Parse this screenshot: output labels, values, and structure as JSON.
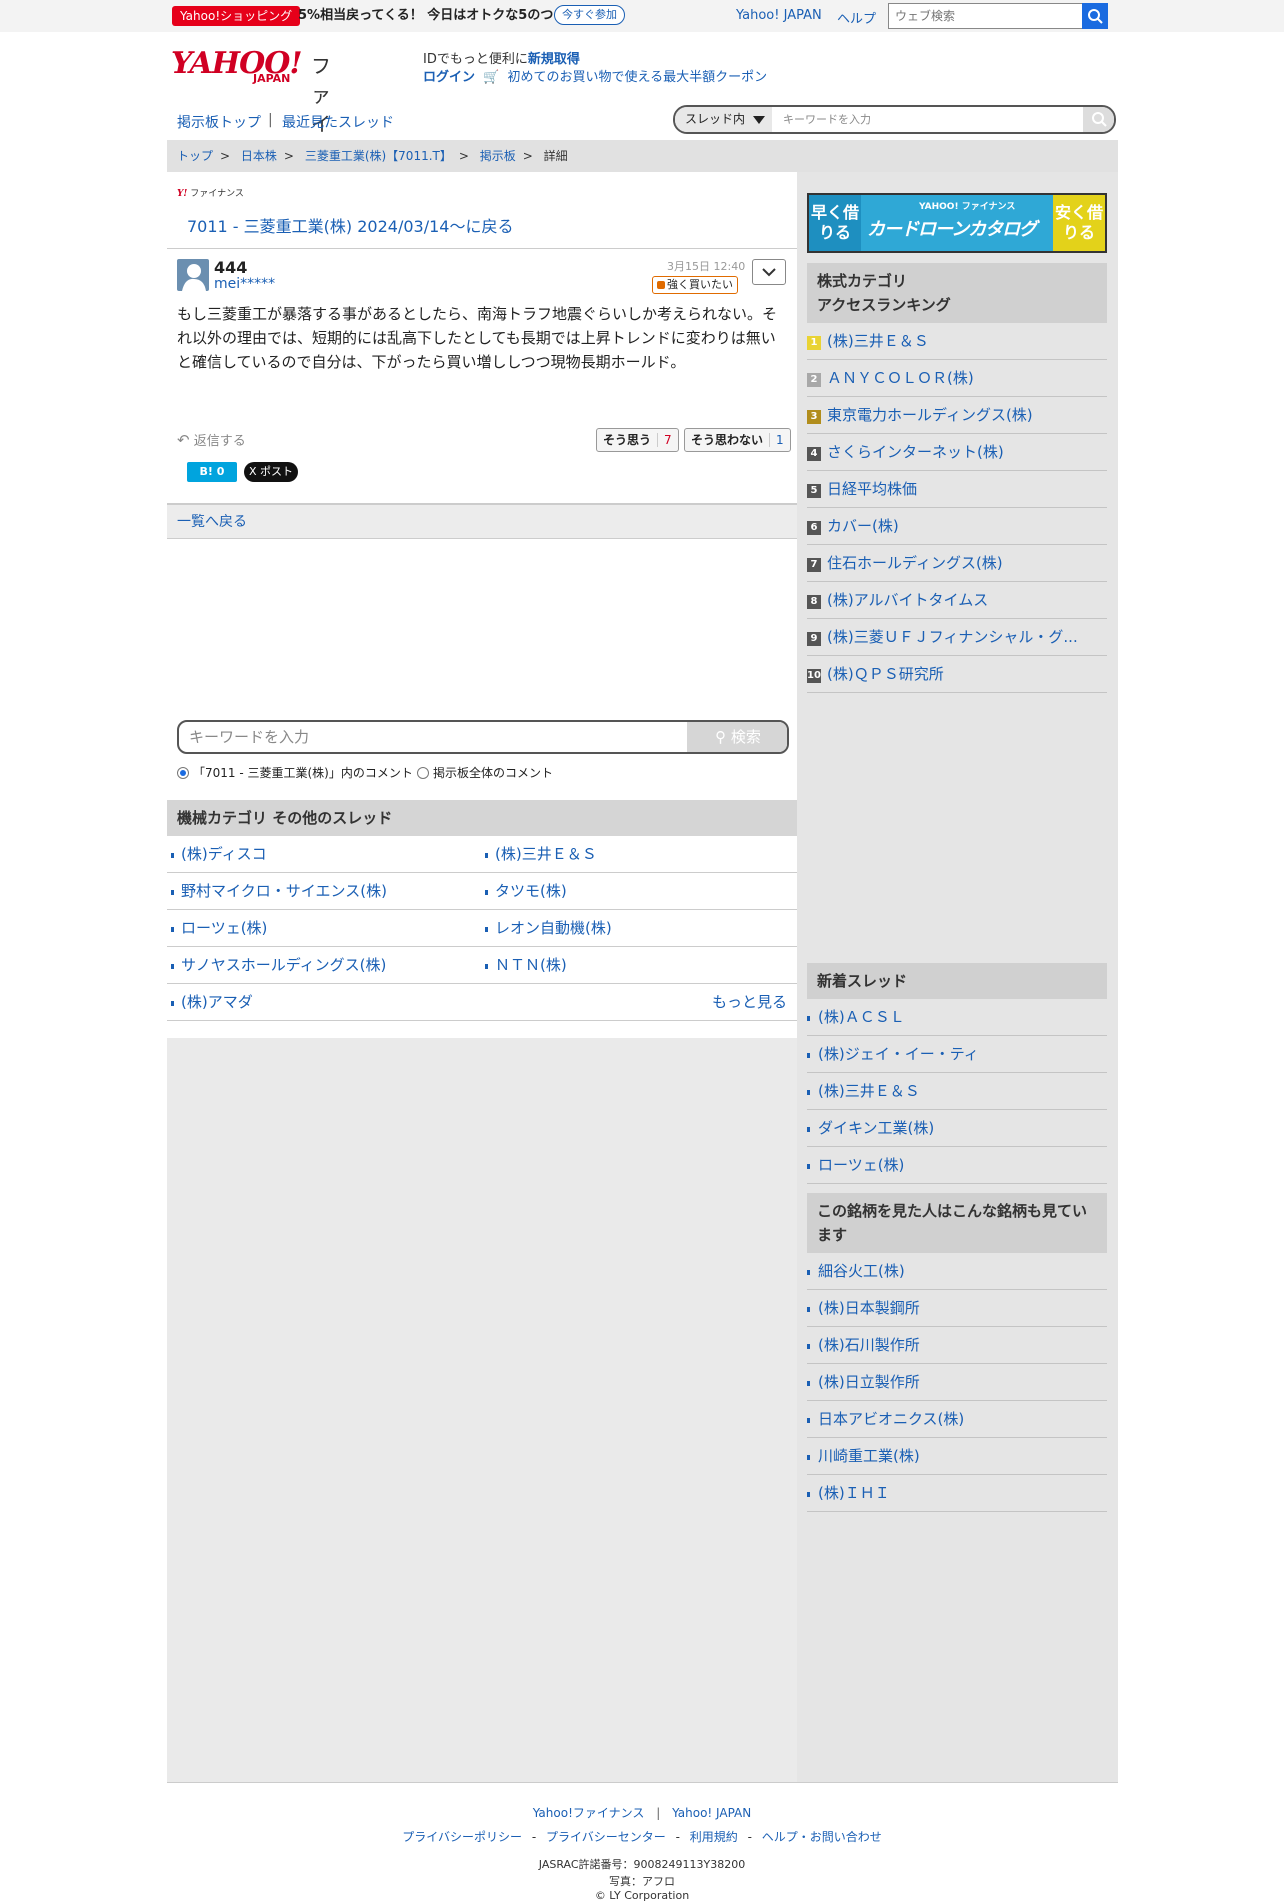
{
  "topbar": {
    "promo_badge": "Yahoo!ショッピング",
    "promo_text": "5%相当戻ってくる！ 今日はオトクな5のつく日",
    "promo_button": "今すぐ参加",
    "link_yahoo_japan": "Yahoo! JAPAN",
    "link_help": "ヘルプ",
    "search_placeholder": "ウェブ検索"
  },
  "header": {
    "logo_yahoo": "YAHOO!",
    "logo_japan": "JAPAN",
    "logo_finance": "ファイナンス",
    "id_prefix": "IDでもっと便利に",
    "id_register": "新規取得",
    "login": "ログイン",
    "coupon": "初めてのお買い物で使える最大半額クーポン"
  },
  "board_nav": {
    "board_top": "掲示板トップ",
    "separator": "|",
    "recent_threads": "最近見たスレッド",
    "scope_select": "スレッド内",
    "search_placeholder": "キーワードを入力"
  },
  "breadcrumb": {
    "items": [
      "トップ",
      ">",
      "日本株",
      ">",
      "三菱重工業(株)【7011.T】",
      ">",
      "掲示板",
      ">",
      "詳細"
    ]
  },
  "thread": {
    "small_logo": "ファイナンス",
    "title": "7011 - 三菱重工業(株) 2024/03/14〜に戻る"
  },
  "post": {
    "number": "444",
    "user": "mei*****",
    "date": "3月15日 12:40",
    "sentiment": "強く買いたい",
    "body": "もし三菱重工が暴落する事があるとしたら、南海トラフ地震ぐらいしか考えられない。それ以外の理由では、短期的には乱高下したとしても長期では上昇トレンドに変わりは無いと確信しているので自分は、下がったら買い増ししつつ現物長期ホールド。",
    "reply": "返信する",
    "agree_label": "そう思う",
    "agree_count": "7",
    "disagree_label": "そう思わない",
    "disagree_count": "1",
    "hatena": "B! 0",
    "x_share": "X ポスト"
  },
  "back_to_list": "一覧へ戻る",
  "keyword_search": {
    "placeholder": "キーワードを入力",
    "button": "検索",
    "radio_thread": "「7011 - 三菱重工業(株)」内のコメント",
    "radio_board": "掲示板全体のコメント"
  },
  "other_threads": {
    "heading": "機械カテゴリ  その他のスレッド",
    "left": [
      "(株)ディスコ",
      "野村マイクロ・サイエンス(株)",
      "ローツェ(株)",
      "サノヤスホールディングス(株)",
      "(株)アマダ"
    ],
    "right": [
      "(株)三井Ｅ＆Ｓ",
      "タツモ(株)",
      "レオン自動機(株)",
      "ＮＴＮ(株)"
    ],
    "more": "もっと見る"
  },
  "sidebar": {
    "ad": {
      "left": "早く借りる",
      "sub": "YAHOO! ファイナンス",
      "title": "カードローンカタログ",
      "right": "安く借りる"
    },
    "ranking_heading": [
      "株式カテゴリ",
      "アクセスランキング"
    ],
    "ranking": [
      {
        "n": "1",
        "name": "(株)三井Ｅ＆Ｓ"
      },
      {
        "n": "2",
        "name": "ＡＮＹＣＯＬＯＲ(株)"
      },
      {
        "n": "3",
        "name": "東京電力ホールディングス(株)"
      },
      {
        "n": "4",
        "name": "さくらインターネット(株)"
      },
      {
        "n": "5",
        "name": "日経平均株価"
      },
      {
        "n": "6",
        "name": "カバー(株)"
      },
      {
        "n": "7",
        "name": "住石ホールディングス(株)"
      },
      {
        "n": "8",
        "name": "(株)アルバイトタイムス"
      },
      {
        "n": "9",
        "name": "(株)三菱ＵＦＪフィナンシャル・グ..."
      },
      {
        "n": "10",
        "name": "(株)ＱＰＳ研究所"
      }
    ],
    "new_heading": "新着スレッド",
    "new_threads": [
      "(株)ＡＣＳＬ",
      "(株)ジェイ・イー・ティ",
      "(株)三井Ｅ＆Ｓ",
      "ダイキン工業(株)",
      "ローツェ(株)"
    ],
    "also_heading": "この銘柄を見た人はこんな銘柄も見ています",
    "also_viewed": [
      "細谷火工(株)",
      "(株)日本製鋼所",
      "(株)石川製作所",
      "(株)日立製作所",
      "日本アビオニクス(株)",
      "川崎重工業(株)",
      "(株)ＩＨＩ"
    ]
  },
  "footer": {
    "link_finance": "Yahoo!ファイナンス",
    "sep": "|",
    "link_yj": "Yahoo! JAPAN",
    "privacy_policy": "プライバシーポリシー",
    "privacy_center": "プライバシーセンター",
    "terms": "利用規約",
    "help": "ヘルプ・お問い合わせ",
    "dash": "-",
    "jasrac": "JASRAC許諾番号：9008249113Y38200",
    "photo": "写真：アフロ",
    "copyright": "© LY Corporation"
  },
  "colors": {
    "link": "#1a5fb4",
    "brand_red": "#d00023",
    "agree": "#d00023",
    "sentiment": "#e06b00"
  }
}
